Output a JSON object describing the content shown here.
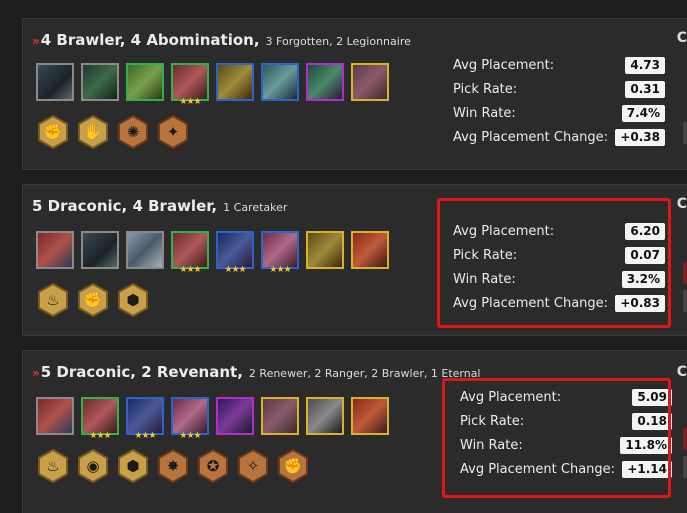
{
  "comps": [
    {
      "title": "4 Brawler, 4 Abomination,",
      "subtitle": "3 Forgotten, 2 Legionnaire",
      "chevron": "»",
      "stats": {
        "avg_placement_label": "Avg Placement:",
        "avg_placement": "4.73",
        "pick_rate_label": "Pick Rate:",
        "pick_rate": "0.31",
        "win_rate_label": "Win Rate:",
        "win_rate": "7.4%",
        "avg_change_label": "Avg Placement Change:",
        "avg_change": "+0.38"
      },
      "highlighted": false
    },
    {
      "title": "5 Draconic, 4 Brawler,",
      "subtitle": "1 Caretaker",
      "chevron": "",
      "stats": {
        "avg_placement_label": "Avg Placement:",
        "avg_placement": "6.20",
        "pick_rate_label": "Pick Rate:",
        "pick_rate": "0.07",
        "win_rate_label": "Win Rate:",
        "win_rate": "3.2%",
        "avg_change_label": "Avg Placement Change:",
        "avg_change": "+0.83"
      },
      "highlighted": true
    },
    {
      "title": "5 Draconic, 2 Revenant,",
      "subtitle": "2 Renewer, 2 Ranger, 2 Brawler, 1 Eternal",
      "chevron": "»",
      "stats": {
        "avg_placement_label": "Avg Placement:",
        "avg_placement": "5.09",
        "pick_rate_label": "Pick Rate:",
        "pick_rate": "0.18",
        "win_rate_label": "Win Rate:",
        "win_rate": "11.8%",
        "avg_change_label": "Avg Placement Change:",
        "avg_change": "+1.14"
      },
      "highlighted": true
    }
  ],
  "stars": "★★★",
  "edge_letter": "C",
  "colors": {
    "highlight": "#e0151b",
    "trait_gold": "#c9a04a",
    "trait_bronze": "#b8743f",
    "star": "#f0c53c"
  }
}
